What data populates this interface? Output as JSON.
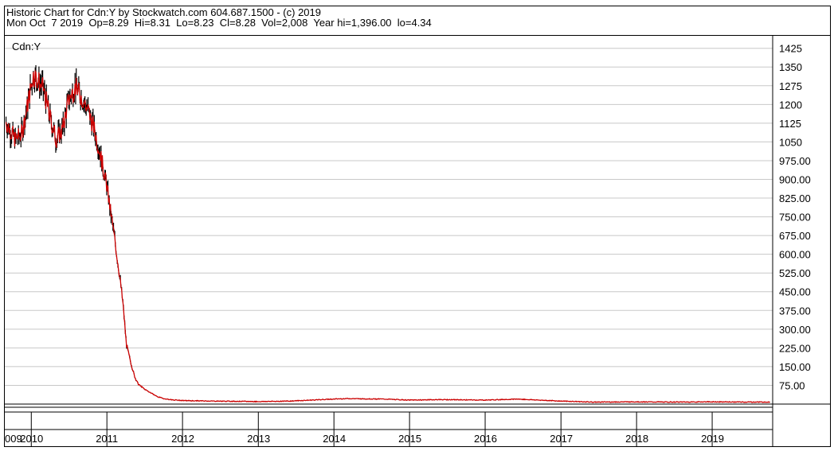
{
  "header": {
    "title": "Historic Chart for Cdn:Y by Stockwatch.com 604.687.1500 - (c) 2019",
    "stats": "Mon Oct  7 2019  Op=8.29  Hi=8.31  Lo=8.23  Cl=8.28  Vol=2,008  Year hi=1,396.00  lo=4.34"
  },
  "chart_data": {
    "type": "line",
    "series": [
      {
        "name": "Cdn:Y",
        "color": "#cc0000",
        "x": [
          "2009-09-01",
          "2009-10-15",
          "2009-11-15",
          "2009-12-15",
          "2010-01-10",
          "2010-02-01",
          "2010-03-01",
          "2010-04-01",
          "2010-05-01",
          "2010-06-01",
          "2010-07-01",
          "2010-08-01",
          "2010-09-01",
          "2010-10-01",
          "2010-11-01",
          "2010-12-01",
          "2011-01-01",
          "2011-02-01",
          "2011-03-01",
          "2011-03-20",
          "2011-04-05",
          "2011-04-25",
          "2011-05-15",
          "2011-06-01",
          "2011-07-01",
          "2011-08-01",
          "2011-09-01",
          "2011-10-01",
          "2011-11-01",
          "2012-01-01",
          "2012-06-01",
          "2013-01-01",
          "2013-06-01",
          "2013-11-01",
          "2014-03-01",
          "2014-09-01",
          "2015-01-01",
          "2015-06-01",
          "2016-01-01",
          "2016-06-01",
          "2017-01-01",
          "2017-06-01",
          "2018-01-01",
          "2018-06-01",
          "2019-01-01",
          "2019-06-01",
          "2019-10-07"
        ],
        "y": [
          1130,
          1060,
          1080,
          1200,
          1320,
          1300,
          1260,
          1150,
          1060,
          1100,
          1220,
          1270,
          1230,
          1180,
          1100,
          1000,
          870,
          700,
          530,
          400,
          240,
          170,
          110,
          80,
          60,
          45,
          30,
          22,
          18,
          14,
          12,
          10,
          12,
          18,
          22,
          20,
          16,
          18,
          16,
          20,
          12,
          8,
          9,
          8,
          9,
          8,
          8.28
        ]
      }
    ],
    "ylim": [
      0,
      1475
    ],
    "yticks": [
      "1425",
      "1350",
      "1275",
      "1200",
      "1125",
      "1050",
      "975.00",
      "900.00",
      "825.00",
      "750.00",
      "675.00",
      "600.00",
      "525.00",
      "450.00",
      "375.00",
      "300.00",
      "225.00",
      "150.00",
      "75.00"
    ],
    "ytick_values": [
      1425,
      1350,
      1275,
      1200,
      1125,
      1050,
      975,
      900,
      825,
      750,
      675,
      600,
      525,
      450,
      375,
      300,
      225,
      150,
      75
    ],
    "xticks": [
      "009",
      "2010",
      "2011",
      "2012",
      "2013",
      "2014",
      "2015",
      "2016",
      "2017",
      "2018",
      "2019"
    ],
    "xtick_dates": [
      "2009-09-01",
      "2010-01-01",
      "2011-01-01",
      "2012-01-01",
      "2013-01-01",
      "2014-01-01",
      "2015-01-01",
      "2016-01-01",
      "2017-01-01",
      "2018-01-01",
      "2019-01-01"
    ],
    "xlim": [
      "2009-08-26",
      "2019-10-20"
    ],
    "grid": true,
    "colors": {
      "price_line": "#cc0000",
      "bars": "#000000",
      "grid": "#c8c8c8"
    }
  }
}
